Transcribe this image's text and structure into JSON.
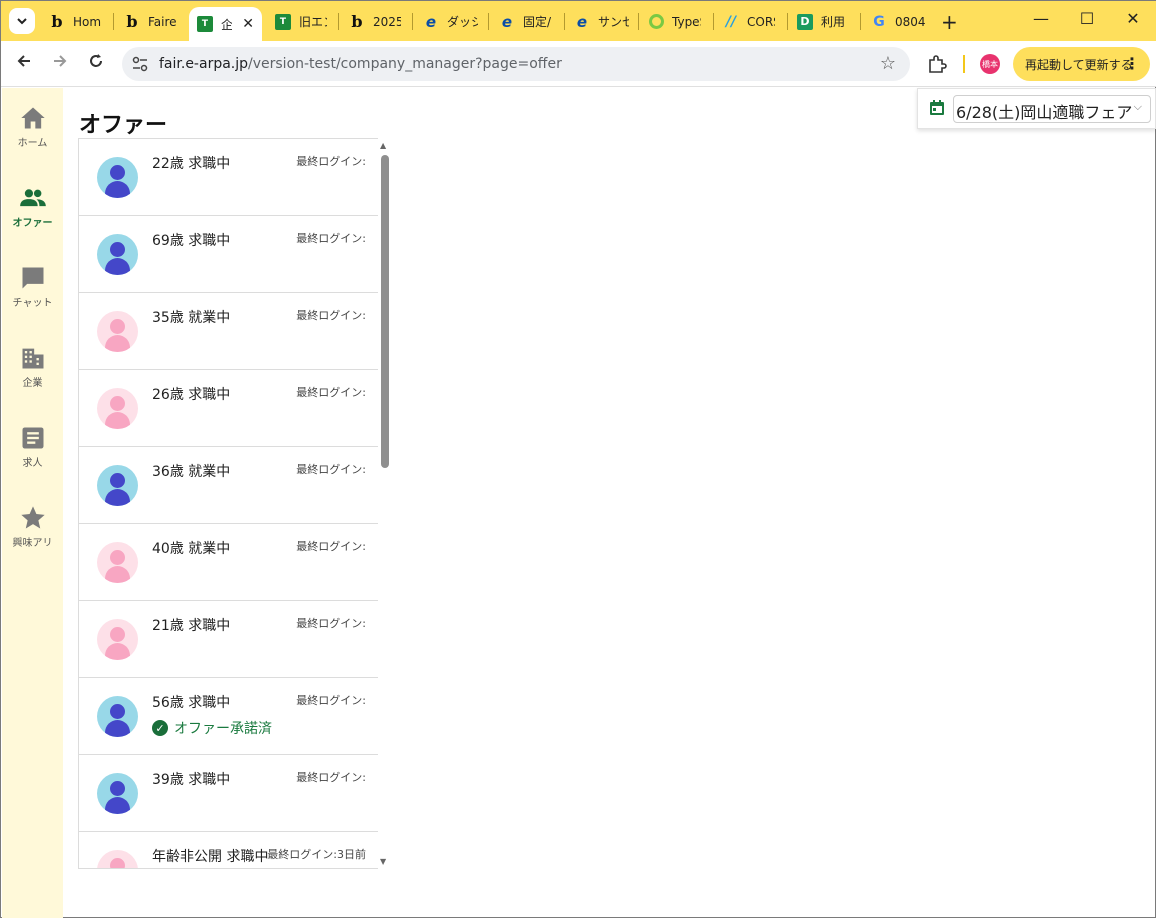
{
  "browser": {
    "tabs": [
      {
        "title": "Home",
        "favicon": "bubble-b-icon"
      },
      {
        "title": "Fairer",
        "favicon": "bubble-b-icon"
      },
      {
        "title": "企",
        "favicon": "green-t-icon",
        "active": true
      },
      {
        "title": "旧エン",
        "favicon": "green-t-icon"
      },
      {
        "title": "2025",
        "favicon": "bubble-b-icon"
      },
      {
        "title": "ダッシ",
        "favicon": "e-icon"
      },
      {
        "title": "固定/",
        "favicon": "e-icon"
      },
      {
        "title": "サンセ",
        "favicon": "e-icon"
      },
      {
        "title": "TypeS",
        "favicon": "typesquare-icon"
      },
      {
        "title": "CORS",
        "favicon": "cors-icon"
      },
      {
        "title": "利用",
        "favicon": "d-icon"
      },
      {
        "title": "0804",
        "favicon": "google-icon"
      }
    ],
    "url_host": "fair.e-arpa.jp",
    "url_path": "/version-test/company_manager?page=offer",
    "profile_initials": "橋本",
    "update_label": "再起動して更新する",
    "accent_color": "#fedf5c"
  },
  "sidenav": {
    "items": [
      {
        "label": "ホーム",
        "icon": "home-icon"
      },
      {
        "label": "オファー",
        "icon": "people-icon",
        "active": true
      },
      {
        "label": "チャット",
        "icon": "chat-icon"
      },
      {
        "label": "企業",
        "icon": "building-icon"
      },
      {
        "label": "求人",
        "icon": "document-icon"
      },
      {
        "label": "興味アリ",
        "icon": "star-icon"
      }
    ]
  },
  "page": {
    "title": "オファー",
    "event_selector": {
      "value": "6/28(土)岡山適職フェア",
      "icon": "calendar-icon"
    }
  },
  "offers": [
    {
      "info": "22歳 求職中",
      "last_login": "最終ログイン:",
      "gender": "male"
    },
    {
      "info": "69歳 求職中",
      "last_login": "最終ログイン:",
      "gender": "male"
    },
    {
      "info": "35歳 就業中",
      "last_login": "最終ログイン:",
      "gender": "female"
    },
    {
      "info": "26歳 求職中",
      "last_login": "最終ログイン:",
      "gender": "female"
    },
    {
      "info": "36歳 就業中",
      "last_login": "最終ログイン:",
      "gender": "male"
    },
    {
      "info": "40歳 就業中",
      "last_login": "最終ログイン:",
      "gender": "female"
    },
    {
      "info": "21歳 求職中",
      "last_login": "最終ログイン:",
      "gender": "female"
    },
    {
      "info": "56歳 求職中",
      "last_login": "最終ログイン:",
      "gender": "male",
      "status": "オファー承諾済"
    },
    {
      "info": "39歳 求職中",
      "last_login": "最終ログイン:",
      "gender": "male"
    },
    {
      "info": "年齢非公開 求職中",
      "last_login": "最終ログイン:3日前",
      "gender": "female"
    }
  ]
}
